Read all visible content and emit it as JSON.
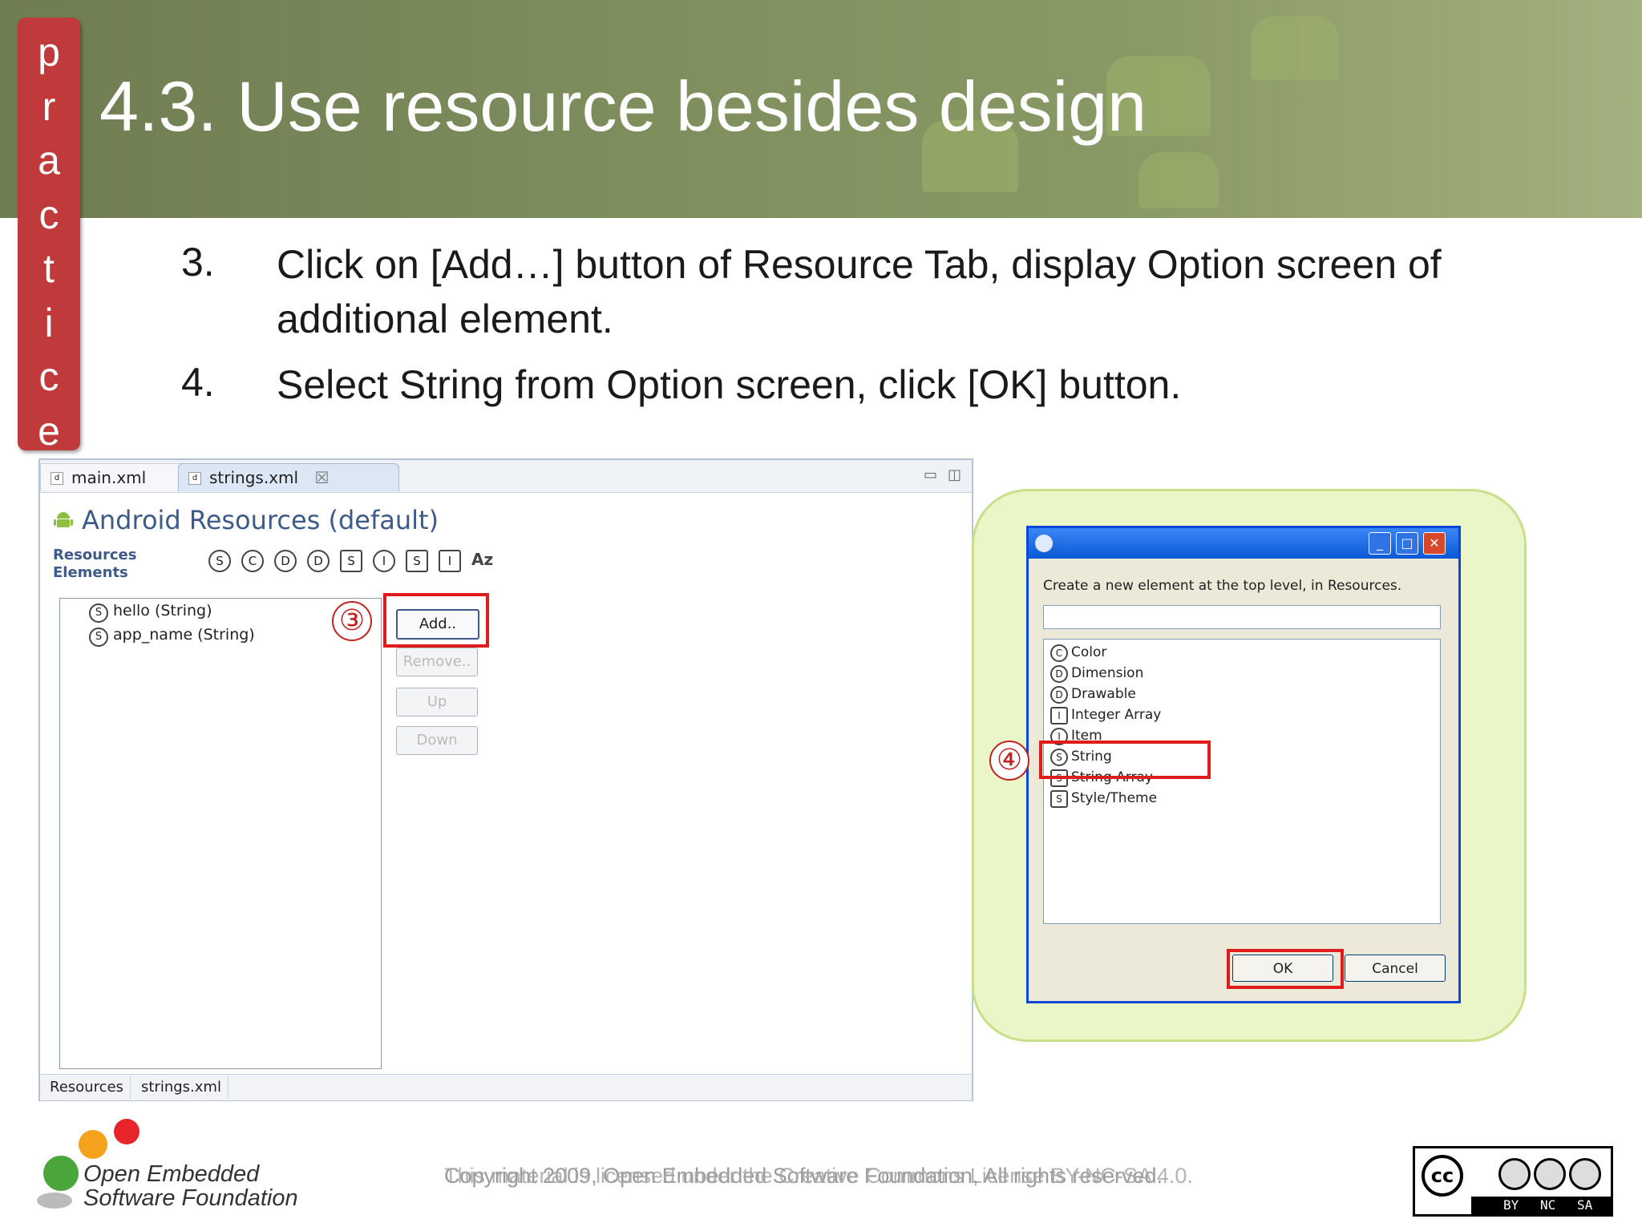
{
  "slide": {
    "title": "4.3. Use resource besides design",
    "side_tab": "practice",
    "steps": [
      {
        "number": "3.",
        "line1": "Click on [Add…] button of Resource Tab, display Option screen of",
        "line2": "additional element."
      },
      {
        "number": "4.",
        "line1": "Select String from Option screen, click [OK] button.",
        "line2": ""
      }
    ]
  },
  "eclipse": {
    "tabs": [
      {
        "label": "main.xml",
        "icon": "xml-file-icon"
      },
      {
        "label": "strings.xml",
        "icon": "xml-file-icon",
        "close": "☒"
      }
    ],
    "panel_title": "Android Resources (default)",
    "section_label_line1": "Resources",
    "section_label_line2": "Elements",
    "icon_strip": [
      "S",
      "C",
      "D",
      "D",
      "S",
      "I",
      "S",
      "I",
      "Az"
    ],
    "tree_items": [
      {
        "icon": "S",
        "label": "hello (String)"
      },
      {
        "icon": "S",
        "label": "app_name (String)"
      }
    ],
    "buttons": {
      "add": "Add..",
      "remove": "Remove..",
      "up": "Up",
      "down": "Down"
    },
    "bottom_tabs": [
      "Resources",
      "strings.xml"
    ],
    "callout_number": "③"
  },
  "dialog": {
    "prompt": "Create a new element at the top level, in Resources.",
    "input_value": "",
    "list_items": [
      {
        "icon": "C",
        "label": "Color"
      },
      {
        "icon": "D",
        "label": "Dimension"
      },
      {
        "icon": "D",
        "label": "Drawable"
      },
      {
        "icon": "I",
        "label": "Integer Array"
      },
      {
        "icon": "I",
        "label": "Item"
      },
      {
        "icon": "S",
        "label": "String"
      },
      {
        "icon": "S",
        "label": "String Array"
      },
      {
        "icon": "S",
        "label": "Style/Theme"
      }
    ],
    "selected_item": "String",
    "ok_label": "OK",
    "cancel_label": "Cancel",
    "callout_number": "④"
  },
  "footer": {
    "org_line1": "Open Embedded",
    "org_line2": "Software Foundation",
    "copyright": "Copyright 2009, Open Embedded Software Foundation, All rights reserved.",
    "license": "This material is licensed under the Creative Commons License BY-NC-SA 4.0.",
    "cc_labels": [
      "BY",
      "NC",
      "SA"
    ],
    "cc_mark": "cc"
  },
  "colors": {
    "header_green": "#7e8e5d",
    "practice_red": "#c0393b",
    "highlight_red": "#e01b1b",
    "callout_green": "#eaf5c8",
    "xp_blue": "#0a58d6"
  }
}
